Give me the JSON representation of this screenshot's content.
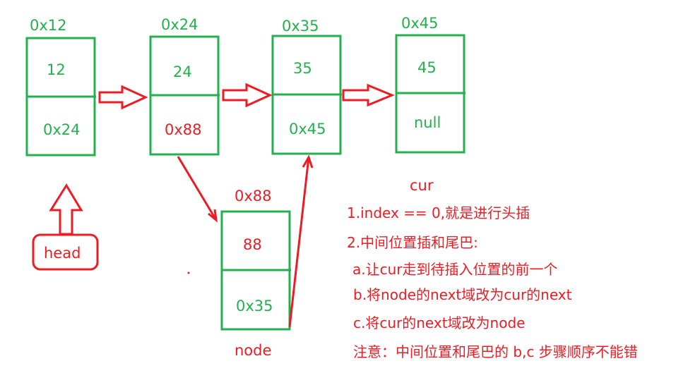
{
  "colors": {
    "green": "#22b14c",
    "red": "#ed1c24"
  },
  "nodes": [
    {
      "address": "0x12",
      "value": "12",
      "next": "0x24",
      "next_color": "green"
    },
    {
      "address": "0x24",
      "value": "24",
      "next": "0x88",
      "next_color": "red"
    },
    {
      "address": "0x35",
      "value": "35",
      "next": "0x45",
      "next_color": "green"
    },
    {
      "address": "0x45",
      "value": "45",
      "next": "null",
      "next_color": "green"
    }
  ],
  "new_node": {
    "address": "0x88",
    "value": "88",
    "next": "0x35",
    "label": "node"
  },
  "head_label": "head",
  "cur_label": "cur",
  "notes": [
    "1.index == 0,就是进行头插",
    "2.中间位置插和尾巴:",
    "a.让cur走到待插入位置的前一个",
    "b.将node的next域改为cur的next",
    "c.将cur的next域改为node",
    "注意：中间位置和尾巴的  b,c 步骤顺序不能错"
  ]
}
